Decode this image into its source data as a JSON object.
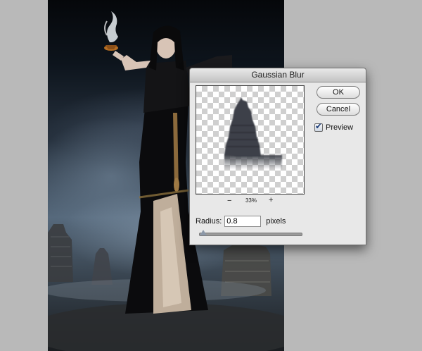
{
  "dialog": {
    "title": "Gaussian Blur",
    "ok_label": "OK",
    "cancel_label": "Cancel",
    "preview_label": "Preview",
    "preview_checked": true,
    "zoom": {
      "minus": "−",
      "value": "33%",
      "plus": "+"
    },
    "radius": {
      "label": "Radius:",
      "value": "0.8",
      "unit": "pixels",
      "slider_level": 0.02
    }
  },
  "icons": {
    "check": "check-mark-icon",
    "zoom_out": "zoom-out-icon",
    "zoom_in": "zoom-in-icon",
    "slider_thumb": "slider-thumb-icon"
  },
  "colors": {
    "dialog_bg": "#e8e8e8",
    "workspace_bg": "#b9b9b9",
    "checkbox_tick": "#1b3c78"
  }
}
